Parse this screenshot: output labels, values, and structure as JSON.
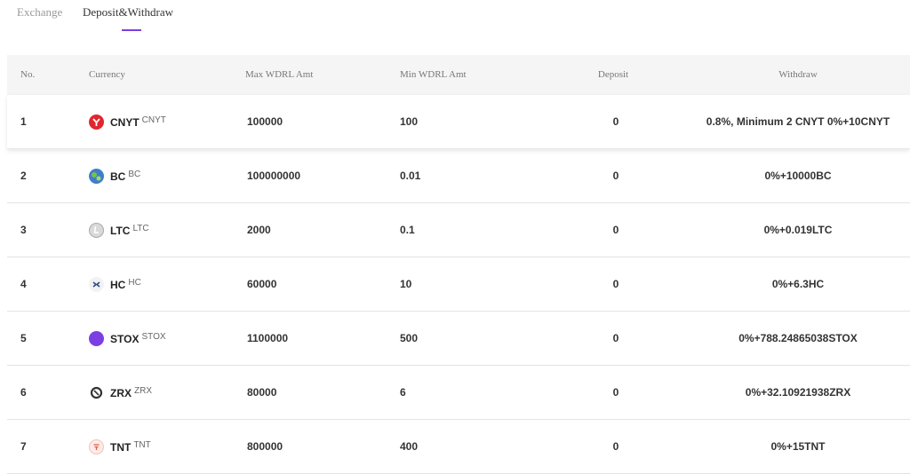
{
  "tabs": [
    {
      "label": "Exchange"
    },
    {
      "label": "Deposit&Withdraw"
    }
  ],
  "columns": {
    "no": "No.",
    "currency": "Currency",
    "max": "Max WDRL Amt",
    "min": "Min WDRL Amt",
    "deposit": "Deposit",
    "withdraw": "Withdraw"
  },
  "rows": [
    {
      "no": "1",
      "symbol": "CNYT",
      "sub": "CNYT",
      "icon": "cnyt-icon",
      "color": "#e0262e",
      "max": "100000",
      "min": "100",
      "deposit": "0",
      "withdraw": "0.8%, Minimum 2 CNYT 0%+10CNYT"
    },
    {
      "no": "2",
      "symbol": "BC",
      "sub": "BC",
      "icon": "bc-icon",
      "color": "#3f7fc8",
      "max": "100000000",
      "min": "0.01",
      "deposit": "0",
      "withdraw": "0%+10000BC"
    },
    {
      "no": "3",
      "symbol": "LTC",
      "sub": "LTC",
      "icon": "ltc-icon",
      "color": "#bdbdbd",
      "max": "2000",
      "min": "0.1",
      "deposit": "0",
      "withdraw": "0%+0.019LTC"
    },
    {
      "no": "4",
      "symbol": "HC",
      "sub": "HC",
      "icon": "hc-icon",
      "color": "#2c4a8a",
      "max": "60000",
      "min": "10",
      "deposit": "0",
      "withdraw": "0%+6.3HC"
    },
    {
      "no": "5",
      "symbol": "STOX",
      "sub": "STOX",
      "icon": "stox-icon",
      "color": "#7b3fe4",
      "max": "1100000",
      "min": "500",
      "deposit": "0",
      "withdraw": "0%+788.24865038STOX"
    },
    {
      "no": "6",
      "symbol": "ZRX",
      "sub": "ZRX",
      "icon": "zrx-icon",
      "color": "#333333",
      "max": "80000",
      "min": "6",
      "deposit": "0",
      "withdraw": "0%+32.10921938ZRX"
    },
    {
      "no": "7",
      "symbol": "TNT",
      "sub": "TNT",
      "icon": "tnt-icon",
      "color": "#e8583a",
      "max": "800000",
      "min": "400",
      "deposit": "0",
      "withdraw": "0%+15TNT"
    }
  ]
}
